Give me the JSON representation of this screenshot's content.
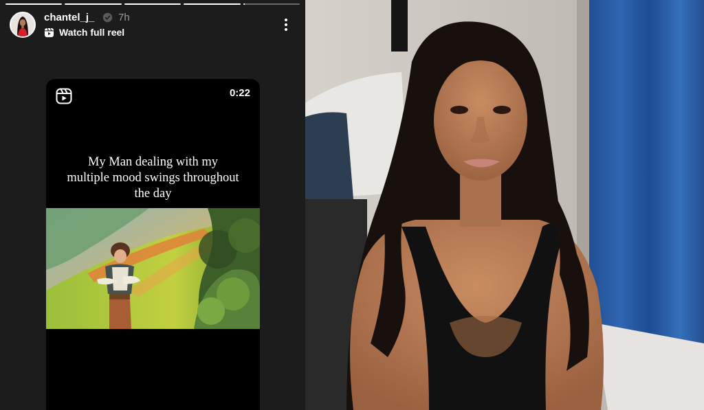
{
  "story": {
    "progress": [
      1,
      1,
      1,
      1,
      0.03
    ],
    "username": "chantel_j_",
    "time": "7h",
    "watch_link": "Watch full reel",
    "icons": {
      "avatar": "profile-photo",
      "verified": "verified-badge-icon",
      "reel": "reels-icon",
      "menu": "more-options-icon"
    }
  },
  "reel": {
    "duration": "0:22",
    "caption": "My Man dealing with my multiple mood swings throughout the day"
  },
  "colors": {
    "background": "#1c1c1c",
    "card": "#000000",
    "text": "#ffffff",
    "muted": "#9a9a9a"
  }
}
